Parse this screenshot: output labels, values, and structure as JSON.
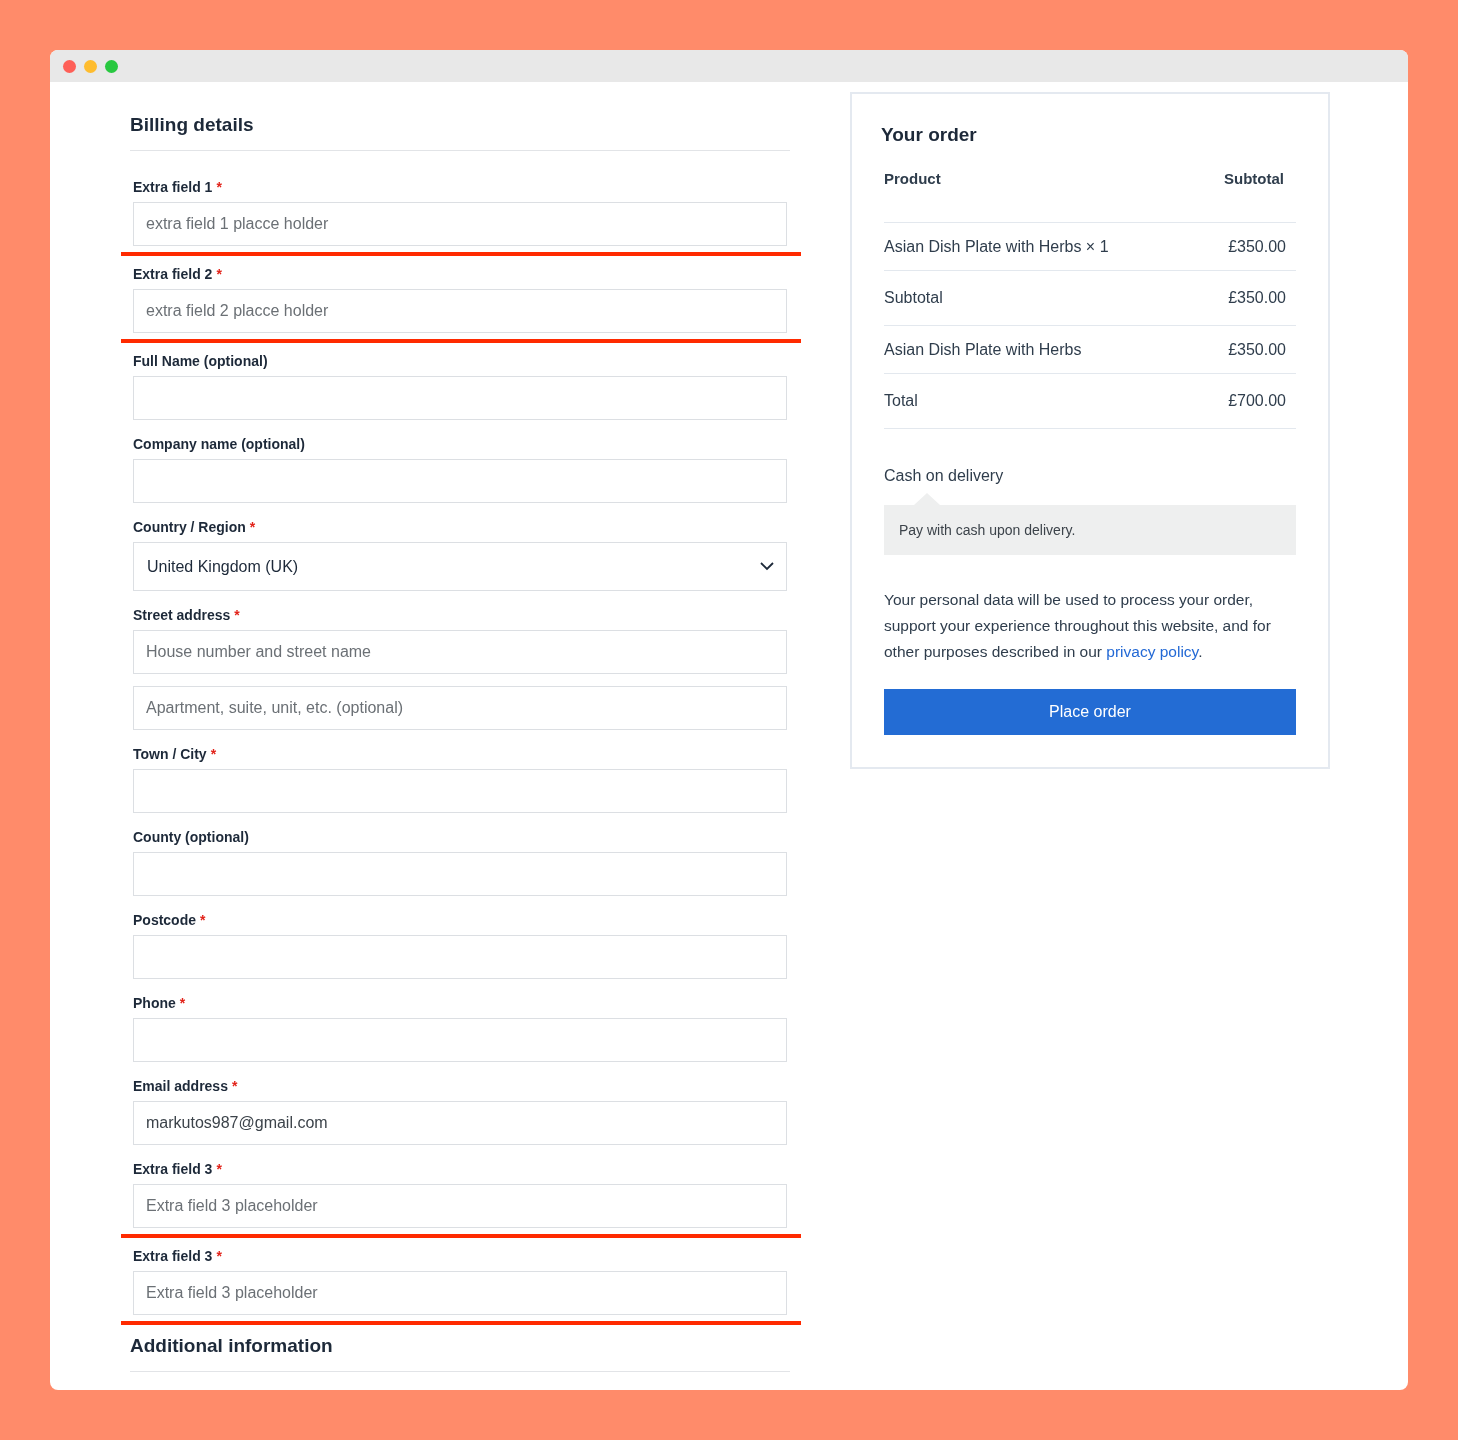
{
  "billing": {
    "title": "Billing details",
    "fields": [
      {
        "kind": "text",
        "label": "Extra field 1",
        "required_mark": "*",
        "highlighted": true,
        "inputs": [
          {
            "placeholder": "extra field 1 placce holder"
          }
        ]
      },
      {
        "kind": "text",
        "label": "Extra field 2",
        "required_mark": "*",
        "highlighted": true,
        "inputs": [
          {
            "placeholder": "extra field 2 placce holder"
          }
        ]
      },
      {
        "kind": "text",
        "label": "Full Name (optional)",
        "highlighted": false
      },
      {
        "kind": "text",
        "label": "Company name (optional)",
        "highlighted": false
      },
      {
        "kind": "select",
        "label": "Country / Region",
        "required_mark": "*",
        "highlighted": false,
        "inputs": [
          {
            "value": "United Kingdom (UK)"
          }
        ]
      },
      {
        "kind": "text",
        "label": "Street address",
        "required_mark": "*",
        "highlighted": false,
        "inputs": [
          {
            "placeholder": "House number and street name"
          },
          {
            "placeholder": "Apartment, suite, unit, etc. (optional)"
          }
        ]
      },
      {
        "kind": "text",
        "label": "Town / City",
        "required_mark": "*",
        "highlighted": false
      },
      {
        "kind": "text",
        "label": "County (optional)",
        "highlighted": false
      },
      {
        "kind": "text",
        "label": "Postcode",
        "required_mark": "*",
        "highlighted": false
      },
      {
        "kind": "text",
        "label": "Phone",
        "required_mark": "*",
        "highlighted": false
      },
      {
        "kind": "text",
        "label": "Email address",
        "required_mark": "*",
        "highlighted": false,
        "inputs": [
          {
            "value": "markutos987@gmail.com"
          }
        ]
      },
      {
        "kind": "text",
        "label": "Extra field 3",
        "required_mark": "*",
        "highlighted": true,
        "inputs": [
          {
            "placeholder": "Extra field 3 placeholder"
          }
        ]
      },
      {
        "kind": "text",
        "label": "Extra field 3",
        "required_mark": "*",
        "highlighted": true,
        "inputs": [
          {
            "placeholder": "Extra field 3 placeholder"
          }
        ]
      }
    ]
  },
  "additional": {
    "title": "Additional information"
  },
  "order": {
    "title": "Your order",
    "columns": [
      "Product",
      "Subtotal"
    ],
    "rows": [
      {
        "kind": "item",
        "label": "Asian Dish Plate with Herbs × 1",
        "amount": "£350.00"
      },
      {
        "kind": "subtotal",
        "label": "Subtotal",
        "amount": "£350.00"
      },
      {
        "kind": "item",
        "label": "Asian Dish Plate with Herbs",
        "amount": "£350.00"
      },
      {
        "kind": "total",
        "label": "Total",
        "amount": "£700.00"
      }
    ],
    "payment": {
      "method": "Cash on delivery",
      "description": "Pay with cash upon delivery."
    },
    "privacy": {
      "text": "Your personal data will be used to process your order, support your experience throughout this website, and for other purposes described in our",
      "link": "privacy policy",
      "after": "."
    },
    "button": "Place order"
  }
}
